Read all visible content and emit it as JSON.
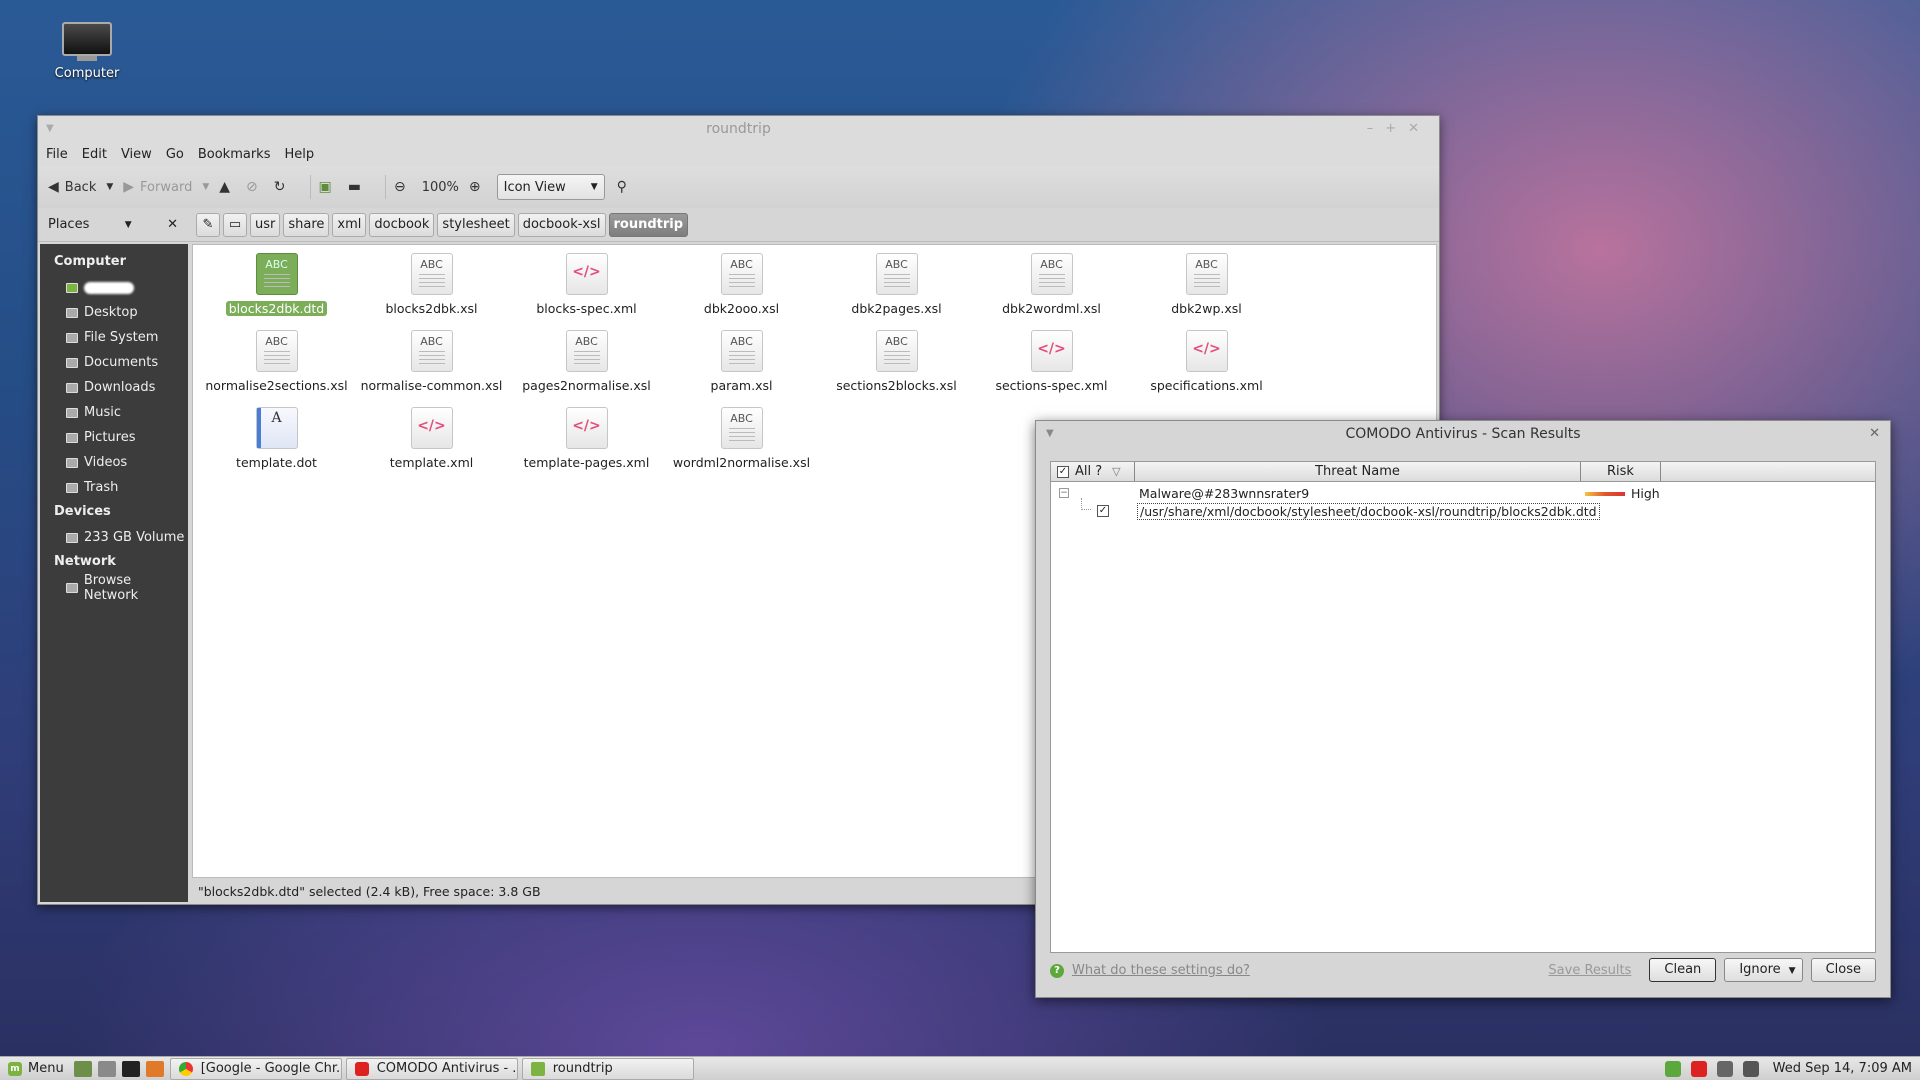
{
  "desktop": {
    "icon_label": "Computer"
  },
  "filemanager": {
    "title": "roundtrip",
    "menu": [
      "File",
      "Edit",
      "View",
      "Go",
      "Bookmarks",
      "Help"
    ],
    "toolbar": {
      "back": "Back",
      "forward": "Forward",
      "zoom": "100%",
      "view_mode": "Icon View"
    },
    "places_label": "Places",
    "breadcrumbs": [
      "usr",
      "share",
      "xml",
      "docbook",
      "stylesheet",
      "docbook-xsl",
      "roundtrip"
    ],
    "sidebar": {
      "computer_header": "Computer",
      "computer_items": [
        "Desktop",
        "File System",
        "Documents",
        "Downloads",
        "Music",
        "Pictures",
        "Videos",
        "Trash"
      ],
      "devices_header": "Devices",
      "devices_items": [
        "233 GB Volume"
      ],
      "network_header": "Network",
      "network_items": [
        "Browse Network"
      ]
    },
    "files": [
      {
        "name": "blocks2dbk.dtd",
        "icon": "abc",
        "selected": true
      },
      {
        "name": "blocks2dbk.xsl",
        "icon": "abc"
      },
      {
        "name": "blocks-spec.xml",
        "icon": "xml"
      },
      {
        "name": "dbk2ooo.xsl",
        "icon": "abc"
      },
      {
        "name": "dbk2pages.xsl",
        "icon": "abc"
      },
      {
        "name": "dbk2wordml.xsl",
        "icon": "abc"
      },
      {
        "name": "dbk2wp.xsl",
        "icon": "abc"
      },
      {
        "name": "normalise2sections.xsl",
        "icon": "abc"
      },
      {
        "name": "normalise-common.xsl",
        "icon": "abc"
      },
      {
        "name": "pages2normalise.xsl",
        "icon": "abc"
      },
      {
        "name": "param.xsl",
        "icon": "abc"
      },
      {
        "name": "sections2blocks.xsl",
        "icon": "abc"
      },
      {
        "name": "sections-spec.xml",
        "icon": "xml"
      },
      {
        "name": "specifications.xml",
        "icon": "xml"
      },
      {
        "name": "template.dot",
        "icon": "dot"
      },
      {
        "name": "template.xml",
        "icon": "xml"
      },
      {
        "name": "template-pages.xml",
        "icon": "xml"
      },
      {
        "name": "wordml2normalise.xsl",
        "icon": "abc"
      }
    ],
    "abc_label": "ABC",
    "xml_glyph": "</>",
    "dot_glyph": "A",
    "status": "\"blocks2dbk.dtd\" selected (2.4 kB), Free space: 3.8 GB"
  },
  "antivirus": {
    "title": "COMODO Antivirus - Scan Results",
    "columns": {
      "all": "All ?",
      "threat": "Threat Name",
      "risk": "Risk"
    },
    "threat_name": "Malware@#283wnnsrater9",
    "risk_level": "High",
    "file_path": "/usr/share/xml/docbook/stylesheet/docbook-xsl/roundtrip/blocks2dbk.dtd",
    "help_link": "What do these settings do?",
    "buttons": {
      "save": "Save Results",
      "clean": "Clean",
      "ignore": "Ignore",
      "close": "Close"
    }
  },
  "taskbar": {
    "menu_label": "Menu",
    "tasks": [
      "[Google - Google Chr...",
      "COMODO Antivirus - ...",
      "roundtrip"
    ],
    "clock": "Wed Sep 14,  7:09 AM"
  },
  "colors": {
    "selection": "#7cae5a",
    "mint": "#7cb342",
    "risk_high": "#d33",
    "xml_icon": "#e44c7a"
  }
}
